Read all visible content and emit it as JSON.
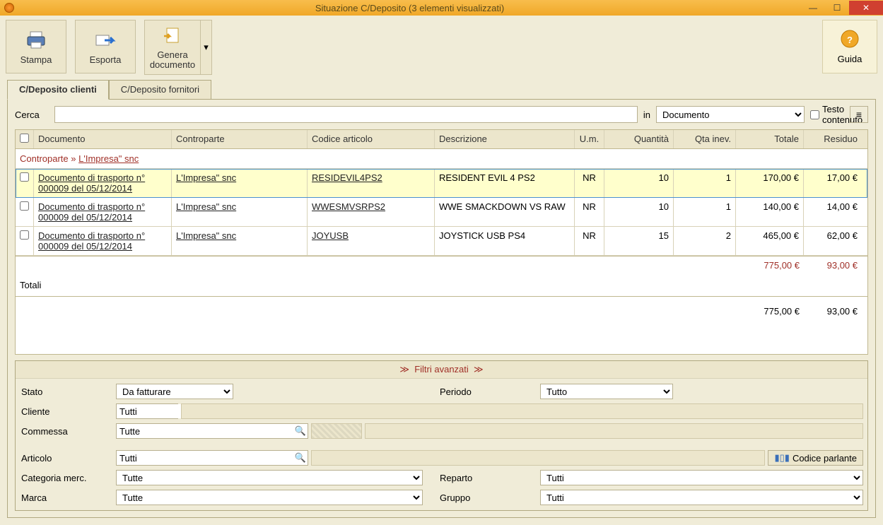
{
  "window": {
    "title": "Situazione C/Deposito (3 elementi visualizzati)"
  },
  "toolbar": {
    "stampa": "Stampa",
    "esporta": "Esporta",
    "genera": "Genera documento",
    "guida": "Guida"
  },
  "tabs": {
    "clienti": "C/Deposito clienti",
    "fornitori": "C/Deposito fornitori"
  },
  "search": {
    "label": "Cerca",
    "in": "in",
    "field": "Documento",
    "testo_contenuto": "Testo contenuto"
  },
  "grid": {
    "headers": {
      "documento": "Documento",
      "controparte": "Controparte",
      "codice": "Codice articolo",
      "descrizione": "Descrizione",
      "um": "U.m.",
      "quantita": "Quantità",
      "qtainev": "Qta inev.",
      "totale": "Totale",
      "residuo": "Residuo"
    },
    "group_label": "Controparte »",
    "group_value": "L'Impresa\" snc",
    "rows": [
      {
        "documento": "Documento di trasporto n° 000009 del 05/12/2014",
        "controparte": "L'Impresa\" snc",
        "codice": "RESIDEVIL4PS2",
        "descrizione": "RESIDENT EVIL 4 PS2",
        "um": "NR",
        "quantita": "10",
        "qtainev": "1",
        "totale": "170,00 €",
        "residuo": "17,00 €"
      },
      {
        "documento": "Documento di trasporto n° 000009 del 05/12/2014",
        "controparte": "L'Impresa\" snc",
        "codice": "WWESMVSRPS2",
        "descrizione": "WWE SMACKDOWN VS RAW",
        "um": "NR",
        "quantita": "10",
        "qtainev": "1",
        "totale": "140,00 €",
        "residuo": "14,00 €"
      },
      {
        "documento": "Documento di trasporto n° 000009 del 05/12/2014",
        "controparte": "L'Impresa\" snc",
        "codice": "JOYUSB",
        "descrizione": "JOYSTICK USB PS4",
        "um": "NR",
        "quantita": "15",
        "qtainev": "2",
        "totale": "465,00 €",
        "residuo": "62,00 €"
      }
    ],
    "subtotal": {
      "totale": "775,00 €",
      "residuo": "93,00 €"
    },
    "totali_label": "Totali",
    "total": {
      "totale": "775,00 €",
      "residuo": "93,00 €"
    }
  },
  "filters": {
    "title": "Filtri avanzati",
    "stato_label": "Stato",
    "stato": "Da fatturare",
    "periodo_label": "Periodo",
    "periodo": "Tutto",
    "cliente_label": "Cliente",
    "cliente": "Tutti",
    "commessa_label": "Commessa",
    "commessa": "Tutte",
    "articolo_label": "Articolo",
    "articolo": "Tutti",
    "codice_parlante": "Codice parlante",
    "categoria_label": "Categoria merc.",
    "categoria": "Tutte",
    "reparto_label": "Reparto",
    "reparto": "Tutti",
    "marca_label": "Marca",
    "marca": "Tutte",
    "gruppo_label": "Gruppo",
    "gruppo": "Tutti"
  }
}
